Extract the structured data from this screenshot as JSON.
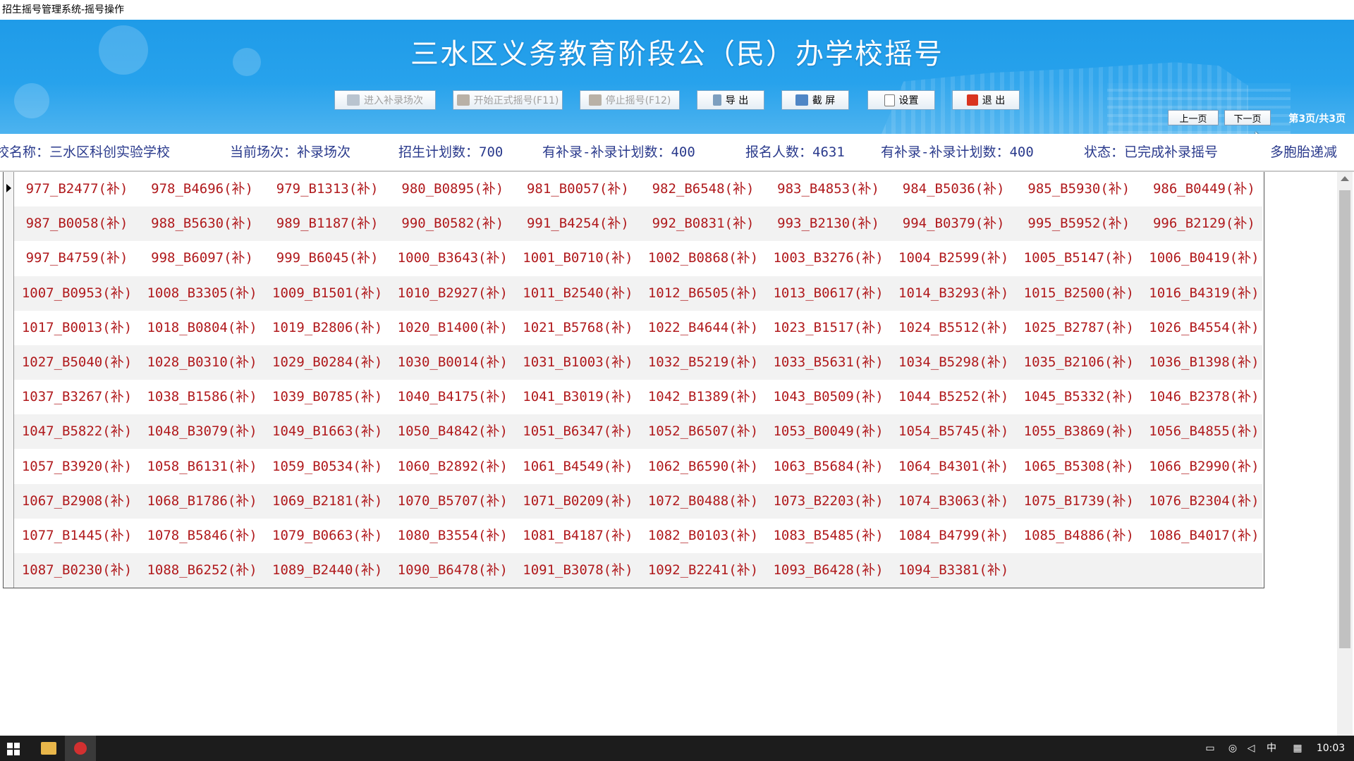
{
  "window": {
    "title": "招生摇号管理系统-摇号操作"
  },
  "header": {
    "title": "三水区义务教育阶段公（民）办学校摇号"
  },
  "toolbar": {
    "enter_supplement": "进入补录场次",
    "start_formal": "开始正式摇号(F11)",
    "stop": "停止摇号(F12)",
    "export": "导 出",
    "screenshot": "截 屏",
    "settings": "设置",
    "exit": "退 出"
  },
  "pager": {
    "prev": "上一页",
    "next": "下一页",
    "info": "第3页/共3页"
  },
  "infobar": {
    "school": "校名称：三水区科创实验学校",
    "session": "当前场次：补录场次",
    "plan": "招生计划数：700",
    "remain1": "有补录-补录计划数：400",
    "applicants": "报名人数：4631",
    "remain2": "有补录-补录计划数：400",
    "status": "状态：已完成补录摇号",
    "twins": "多胞胎递减"
  },
  "grid": {
    "rows": [
      [
        "977_B2477(补)",
        "978_B4696(补)",
        "979_B1313(补)",
        "980_B0895(补)",
        "981_B0057(补)",
        "982_B6548(补)",
        "983_B4853(补)",
        "984_B5036(补)",
        "985_B5930(补)",
        "986_B0449(补)"
      ],
      [
        "987_B0058(补)",
        "988_B5630(补)",
        "989_B1187(补)",
        "990_B0582(补)",
        "991_B4254(补)",
        "992_B0831(补)",
        "993_B2130(补)",
        "994_B0379(补)",
        "995_B5952(补)",
        "996_B2129(补)"
      ],
      [
        "997_B4759(补)",
        "998_B6097(补)",
        "999_B6045(补)",
        "1000_B3643(补)",
        "1001_B0710(补)",
        "1002_B0868(补)",
        "1003_B3276(补)",
        "1004_B2599(补)",
        "1005_B5147(补)",
        "1006_B0419(补)"
      ],
      [
        "1007_B0953(补)",
        "1008_B3305(补)",
        "1009_B1501(补)",
        "1010_B2927(补)",
        "1011_B2540(补)",
        "1012_B6505(补)",
        "1013_B0617(补)",
        "1014_B3293(补)",
        "1015_B2500(补)",
        "1016_B4319(补)"
      ],
      [
        "1017_B0013(补)",
        "1018_B0804(补)",
        "1019_B2806(补)",
        "1020_B1400(补)",
        "1021_B5768(补)",
        "1022_B4644(补)",
        "1023_B1517(补)",
        "1024_B5512(补)",
        "1025_B2787(补)",
        "1026_B4554(补)"
      ],
      [
        "1027_B5040(补)",
        "1028_B0310(补)",
        "1029_B0284(补)",
        "1030_B0014(补)",
        "1031_B1003(补)",
        "1032_B5219(补)",
        "1033_B5631(补)",
        "1034_B5298(补)",
        "1035_B2106(补)",
        "1036_B1398(补)"
      ],
      [
        "1037_B3267(补)",
        "1038_B1586(补)",
        "1039_B0785(补)",
        "1040_B4175(补)",
        "1041_B3019(补)",
        "1042_B1389(补)",
        "1043_B0509(补)",
        "1044_B5252(补)",
        "1045_B5332(补)",
        "1046_B2378(补)"
      ],
      [
        "1047_B5822(补)",
        "1048_B3079(补)",
        "1049_B1663(补)",
        "1050_B4842(补)",
        "1051_B6347(补)",
        "1052_B6507(补)",
        "1053_B0049(补)",
        "1054_B5745(补)",
        "1055_B3869(补)",
        "1056_B4855(补)"
      ],
      [
        "1057_B3920(补)",
        "1058_B6131(补)",
        "1059_B0534(补)",
        "1060_B2892(补)",
        "1061_B4549(补)",
        "1062_B6590(补)",
        "1063_B5684(补)",
        "1064_B4301(补)",
        "1065_B5308(补)",
        "1066_B2990(补)"
      ],
      [
        "1067_B2908(补)",
        "1068_B1786(补)",
        "1069_B2181(补)",
        "1070_B5707(补)",
        "1071_B0209(补)",
        "1072_B0488(补)",
        "1073_B2203(补)",
        "1074_B3063(补)",
        "1075_B1739(补)",
        "1076_B2304(补)"
      ],
      [
        "1077_B1445(补)",
        "1078_B5846(补)",
        "1079_B0663(补)",
        "1080_B3554(补)",
        "1081_B4187(补)",
        "1082_B0103(补)",
        "1083_B5485(补)",
        "1084_B4799(补)",
        "1085_B4886(补)",
        "1086_B4017(补)"
      ],
      [
        "1087_B0230(补)",
        "1088_B6252(补)",
        "1089_B2440(补)",
        "1090_B6478(补)",
        "1091_B3078(补)",
        "1092_B2241(补)",
        "1093_B6428(补)",
        "1094_B3381(补)",
        "",
        ""
      ]
    ]
  },
  "taskbar": {
    "ime": "中",
    "time": "10:03"
  }
}
